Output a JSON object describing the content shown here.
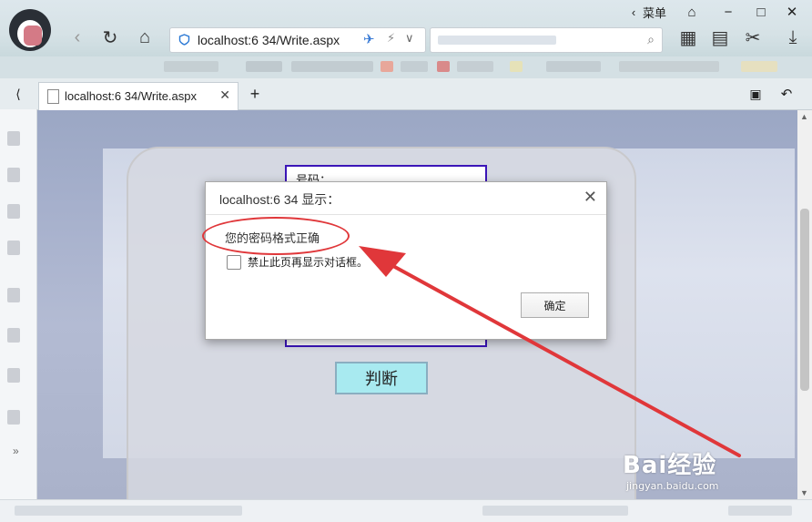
{
  "browser": {
    "menu_label": "菜单",
    "address": {
      "url": "localhost:6  34/Write.aspx"
    },
    "tab": {
      "title": "localhost:6  34/Write.aspx"
    }
  },
  "page": {
    "form_label": "号码：",
    "judge_button": "判断"
  },
  "dialog": {
    "title": "localhost:6  34 显示：",
    "message": "您的密码格式正确",
    "checkbox_label": "禁止此页再显示对话框。",
    "ok_button": "确定"
  },
  "watermark": {
    "brand": "Bai经验",
    "url": "jingyan.baidu.com"
  },
  "colors": {
    "annotation": "#e0373a",
    "form_border": "#3b15b8",
    "judge_bg": "#a8eaf0"
  }
}
